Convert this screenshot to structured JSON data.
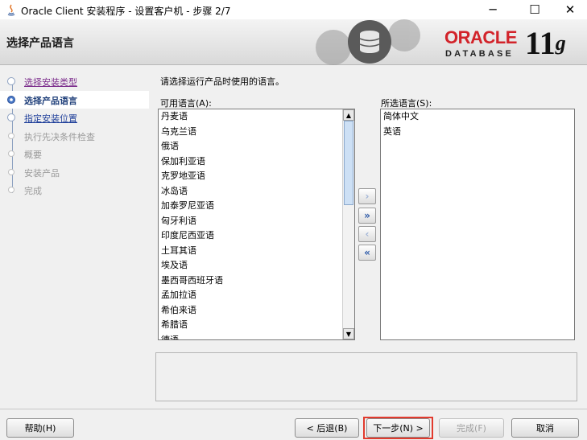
{
  "window": {
    "title": "Oracle Client 安装程序 - 设置客户机 - 步骤 2/7",
    "minimize": "─",
    "maximize": "☐",
    "close": "✕"
  },
  "banner": {
    "title": "选择产品语言",
    "oracle": "ORACLE",
    "database": "DATABASE",
    "version_main": "11",
    "version_sup": "g"
  },
  "steps": [
    {
      "label": "选择安装类型",
      "state": "visited"
    },
    {
      "label": "选择产品语言",
      "state": "current"
    },
    {
      "label": "指定安装位置",
      "state": "link"
    },
    {
      "label": "执行先决条件检查",
      "state": "disabled"
    },
    {
      "label": "概要",
      "state": "disabled"
    },
    {
      "label": "安装产品",
      "state": "disabled"
    },
    {
      "label": "完成",
      "state": "disabled"
    }
  ],
  "main": {
    "prompt": "请选择运行产品时使用的语言。",
    "available_label": "可用语言(A):",
    "selected_label": "所选语言(S):",
    "available": [
      "丹麦语",
      "乌克兰语",
      "俄语",
      "保加利亚语",
      "克罗地亚语",
      "冰岛语",
      "加泰罗尼亚语",
      "匈牙利语",
      "印度尼西亚语",
      "土耳其语",
      "埃及语",
      "墨西哥西班牙语",
      "孟加拉语",
      "希伯来语",
      "希腊语",
      "德语"
    ],
    "selected": [
      "简体中文",
      "英语"
    ],
    "move_buttons": {
      "add": "›",
      "add_all": "»",
      "remove": "‹",
      "remove_all": "«"
    }
  },
  "buttons": {
    "help": "帮助(H)",
    "back": "< 后退(B)",
    "next": "下一步(N) >",
    "finish": "完成(F)",
    "cancel": "取消"
  },
  "colors": {
    "accent": "#1f3f7a",
    "oracle_red": "#d2232a",
    "highlight": "#e23b2e"
  }
}
